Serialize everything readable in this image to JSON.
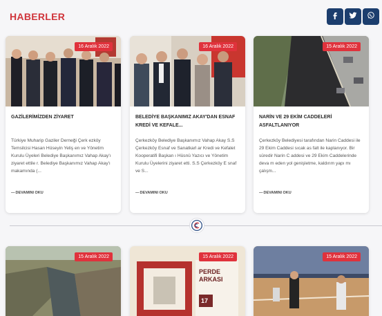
{
  "header": {
    "title": "HABERLER",
    "social": [
      {
        "name": "facebook-icon",
        "glyph": "f"
      },
      {
        "name": "twitter-icon",
        "glyph": ""
      },
      {
        "name": "whatsapp-icon",
        "glyph": ""
      }
    ]
  },
  "colors": {
    "accent": "#d0353b",
    "badge": "#e0323c",
    "social": "#1c3e6e"
  },
  "news": [
    {
      "date": "16 Aralık 2022",
      "title": "GAZİLERİMİZDEN ZİYARET",
      "excerpt": "Türkiye Muharip Gaziler Derneği Çerk ezköy Temsilcisi Hasan Hüseyin Yeliş en ve Yönetim Kurulu Üyeleri Belediye Başkanımız Vahap Akay'ı ziyaret ettile r. Belediye Başkanımız Vahap Akay'ı makamında (...",
      "read_more": "DEVAMINI OKU"
    },
    {
      "date": "16 Aralık 2022",
      "title": "BELEDİYE BAŞKANIMIZ AKAY'DAN ESNAF KREDİ VE KEFALE...",
      "excerpt": "Çerkezköy Belediye Başkanımız Vahap Akay S.S Çerkezköy Esnaf ve Sanatkarl ar Kredi ve Kefalet Kooperatifi Başkan ı Hüsnü Yazıcı ve Yönetim Kurulu Üyelerini ziyaret etti. S.S Çerkezköy E snaf ve S...",
      "read_more": "DEVAMINI OKU"
    },
    {
      "date": "15 Aralık 2022",
      "title": "NARİN VE 29 EKİM CADDELERİ ASFALTLANIYOR",
      "excerpt": "Çerkezköy Belediyesi tarafından Narin Caddesi ile 29 Ekim Caddesi sıcak as falt ile kaplanıyor. Bir süredir Narin C addesi ve 29 Ekim Caddelerinde deva m eden yol genişletme, kaldırım yapı mı çalışm...",
      "read_more": "DEVAMINI OKU"
    }
  ],
  "news_row2": [
    {
      "date": "15 Aralık 2022"
    },
    {
      "date": "15 Aralık 2022",
      "poster_title": "PERDE ARKASI",
      "poster_day": "17"
    },
    {
      "date": "15 Aralık 2022"
    }
  ]
}
